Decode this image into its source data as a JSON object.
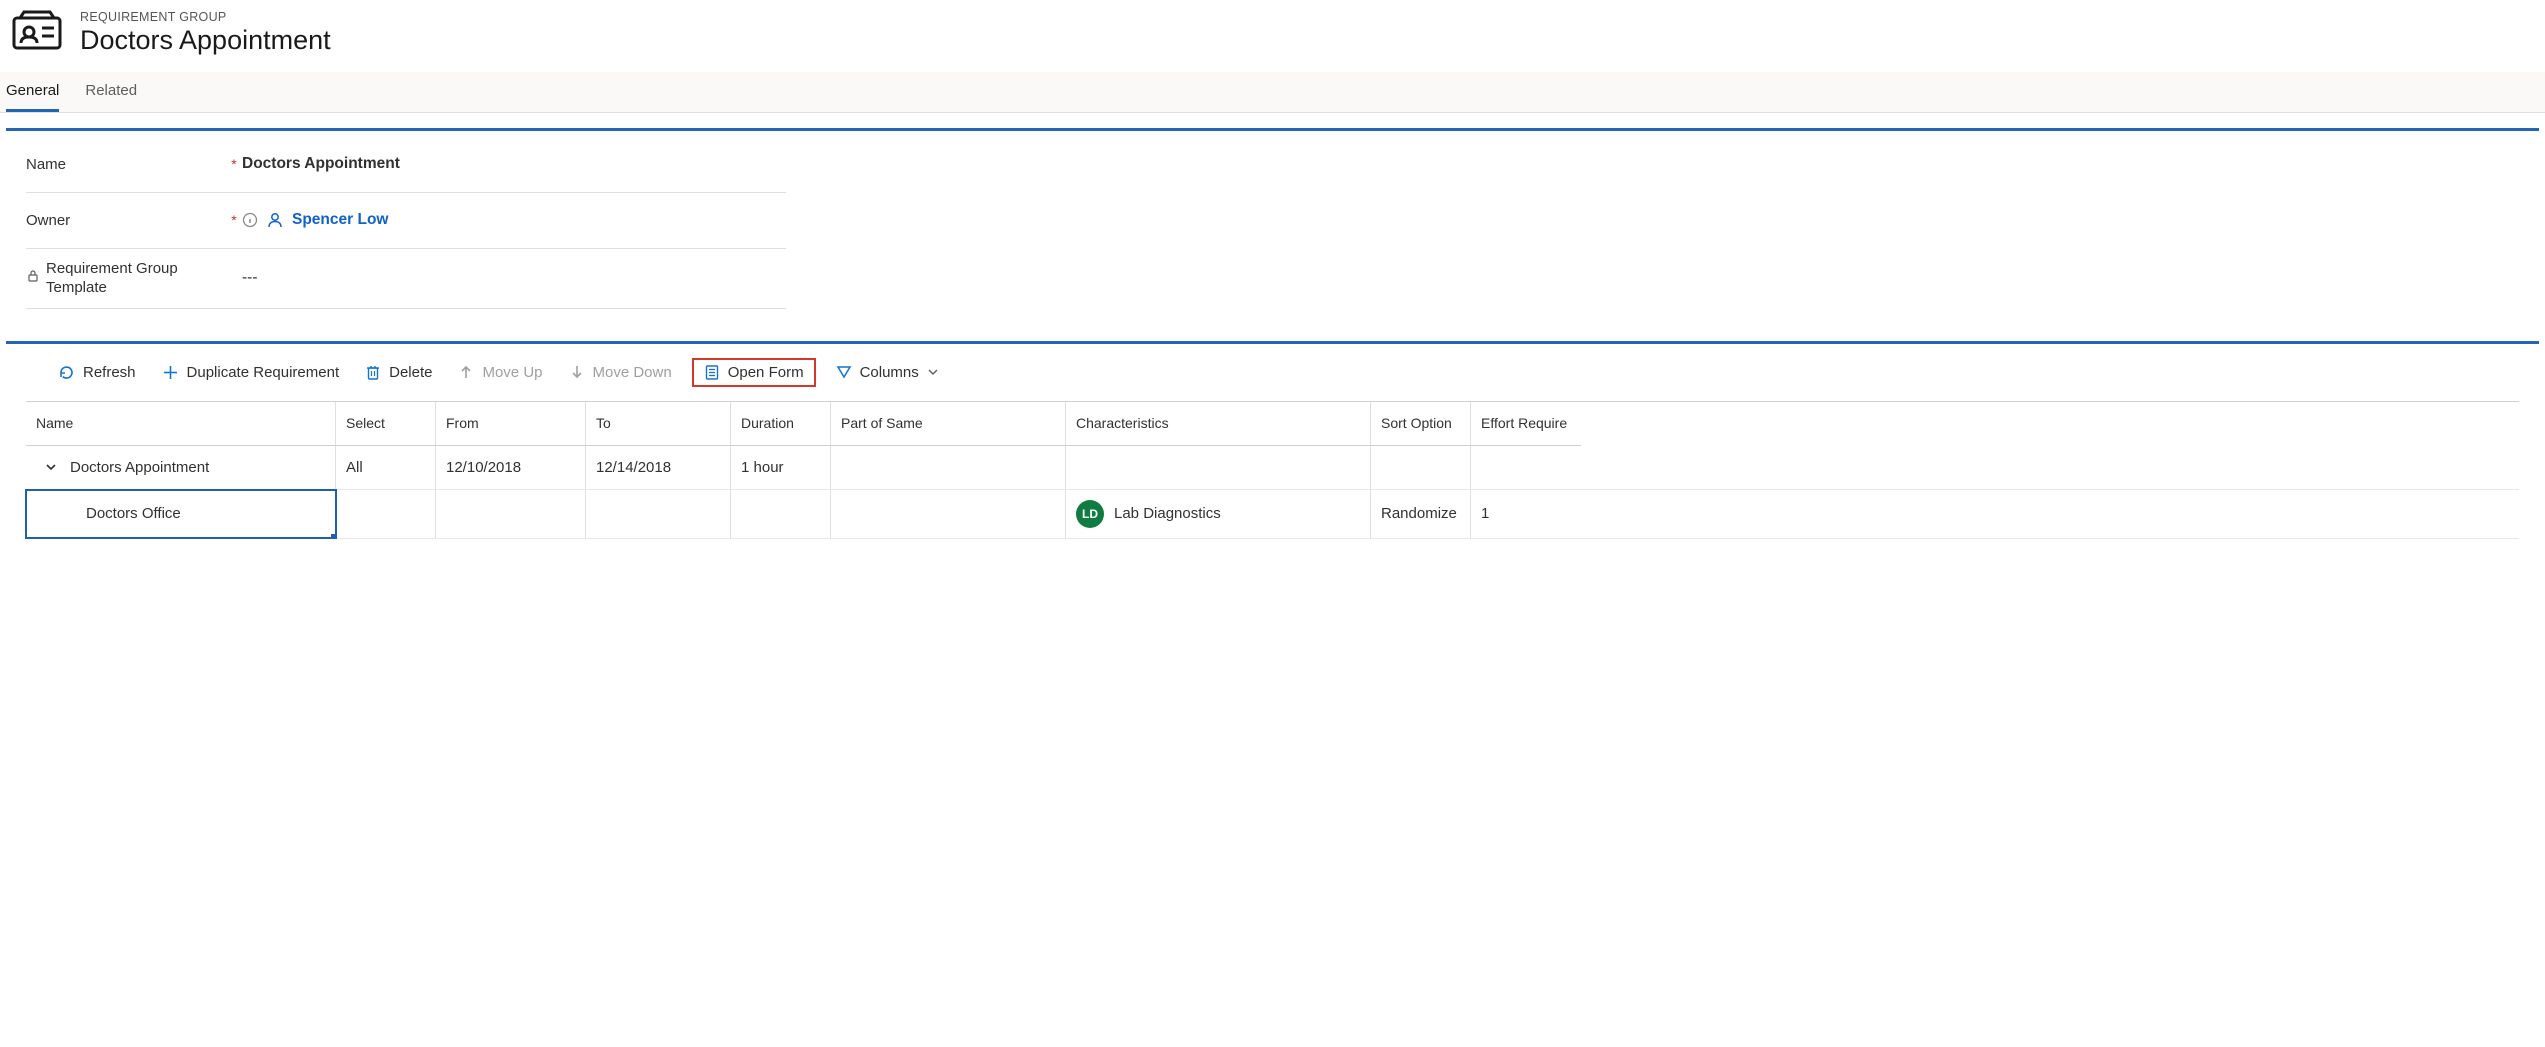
{
  "header": {
    "eyebrow": "REQUIREMENT GROUP",
    "title": "Doctors Appointment"
  },
  "tabs": [
    {
      "label": "General",
      "active": true
    },
    {
      "label": "Related",
      "active": false
    }
  ],
  "fields": {
    "name_label": "Name",
    "name_value": "Doctors Appointment",
    "owner_label": "Owner",
    "owner_value": "Spencer Low",
    "template_label": "Requirement Group Template",
    "template_value": "---"
  },
  "toolbar": {
    "refresh": "Refresh",
    "duplicate": "Duplicate Requirement",
    "delete": "Delete",
    "moveup": "Move Up",
    "movedown": "Move Down",
    "openform": "Open Form",
    "columns": "Columns"
  },
  "grid": {
    "headers": {
      "name": "Name",
      "select": "Select",
      "from": "From",
      "to": "To",
      "duration": "Duration",
      "part": "Part of Same",
      "char": "Characteristics",
      "sort": "Sort Option",
      "effort": "Effort Require"
    },
    "rows": [
      {
        "type": "parent",
        "name": "Doctors Appointment",
        "select": "All",
        "from": "12/10/2018",
        "to": "12/14/2018",
        "duration": "1 hour",
        "part": "",
        "char": "",
        "char_initials": "",
        "sort": "",
        "effort": ""
      },
      {
        "type": "child",
        "selected": true,
        "name": "Doctors Office",
        "select": "",
        "from": "",
        "to": "",
        "duration": "",
        "part": "",
        "char": "Lab Diagnostics",
        "char_initials": "LD",
        "sort": "Randomize",
        "effort": "1"
      }
    ]
  }
}
